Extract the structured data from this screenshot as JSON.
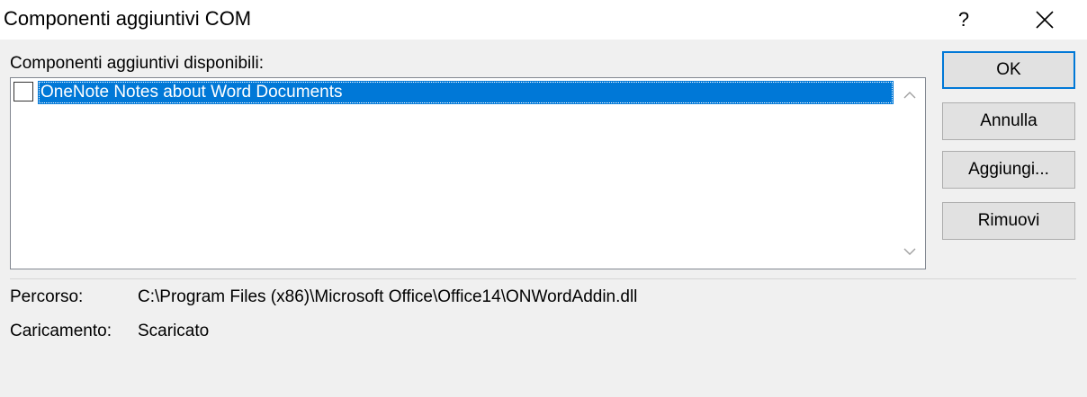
{
  "window": {
    "title": "Componenti aggiuntivi COM",
    "help_label": "?",
    "close_icon": "close-icon"
  },
  "addins": {
    "label": "Componenti aggiuntivi disponibili:",
    "items": [
      {
        "label": "OneNote Notes about Word Documents",
        "checked": false,
        "selected": true
      }
    ]
  },
  "buttons": {
    "ok": "OK",
    "cancel": "Annulla",
    "add": "Aggiungi...",
    "remove": "Rimuovi"
  },
  "details": {
    "path_label": "Percorso:",
    "path_value": "C:\\Program Files (x86)\\Microsoft Office\\Office14\\ONWordAddin.dll",
    "load_label": "Caricamento:",
    "load_value": "Scaricato"
  },
  "colors": {
    "selection": "#0078d7",
    "background": "#f0f0f0"
  }
}
